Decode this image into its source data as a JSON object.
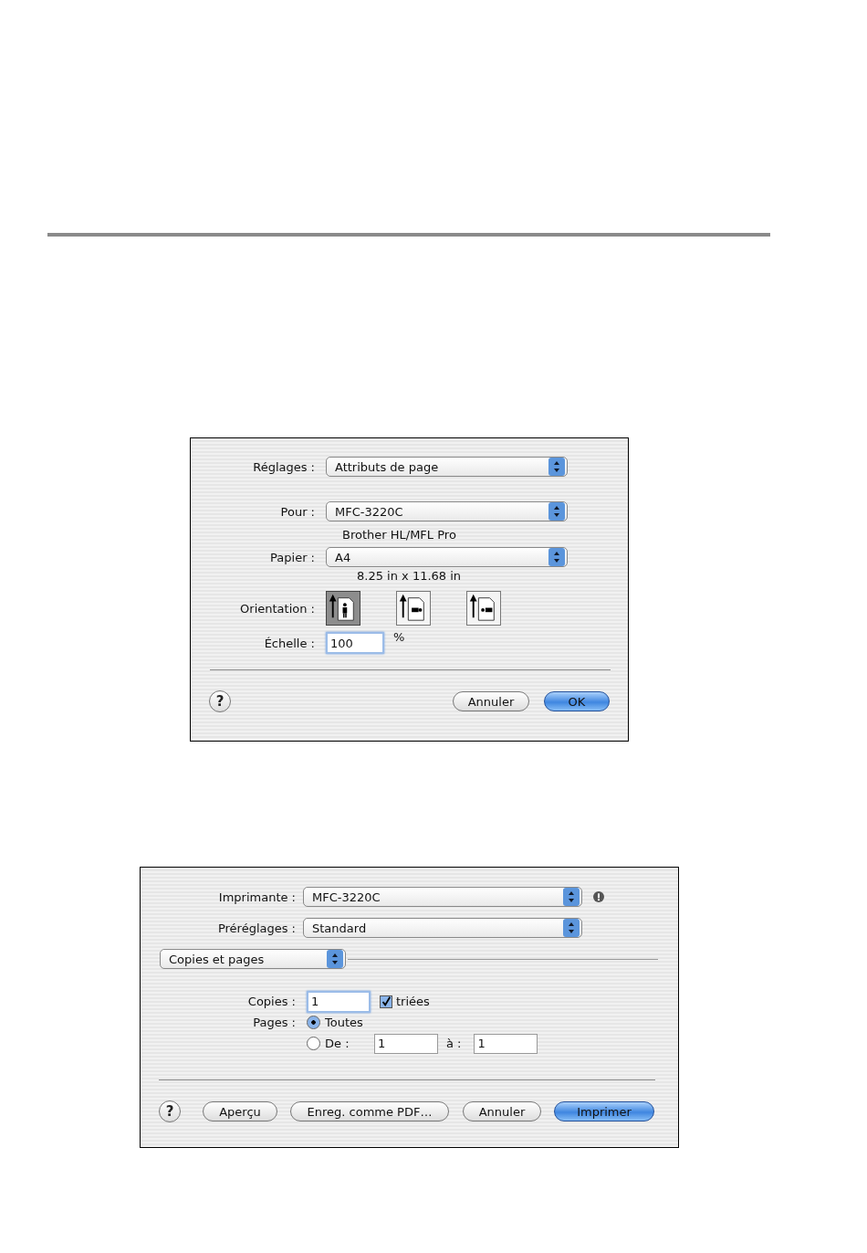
{
  "page_setup": {
    "settings": {
      "label": "Réglages :",
      "value": "Attributs de page"
    },
    "format_for": {
      "label": "Pour :",
      "value": "MFC-3220C"
    },
    "printer_description": "Brother HL/MFL Pro",
    "paper": {
      "label": "Papier :",
      "value": "A4"
    },
    "paper_size": "8.25 in x 11.68 in",
    "orientation": {
      "label": "Orientation :",
      "options": [
        {
          "kind": "portrait",
          "selected": true
        },
        {
          "kind": "landscape",
          "selected": false
        },
        {
          "kind": "landscape_reverse",
          "selected": false
        }
      ]
    },
    "scale": {
      "label": "Échelle :",
      "value": "100",
      "unit": "%"
    },
    "help": "?",
    "buttons": [
      {
        "label": "Annuler",
        "default": false
      },
      {
        "label": "OK",
        "default": true
      }
    ]
  },
  "print": {
    "printer": {
      "label": "Imprimante :",
      "value": "MFC-3220C"
    },
    "presets": {
      "label": "Préréglages :",
      "value": "Standard"
    },
    "panel": "Copies et pages",
    "copies": {
      "label": "Copies :",
      "value": "1"
    },
    "collated": {
      "label": "triées",
      "checked": true
    },
    "pages": {
      "label": "Pages :",
      "options": [
        {
          "label": "Toutes",
          "selected": true
        },
        {
          "label": "De :",
          "selected": false
        }
      ]
    },
    "from_value": "1",
    "to": {
      "label": "à :",
      "value": "1"
    },
    "help": "?",
    "buttons": [
      {
        "label": "Aperçu",
        "default": false
      },
      {
        "label": "Enreg. comme PDF…",
        "default": false
      },
      {
        "label": "Annuler",
        "default": false
      },
      {
        "label": "Imprimer",
        "default": true
      }
    ]
  }
}
